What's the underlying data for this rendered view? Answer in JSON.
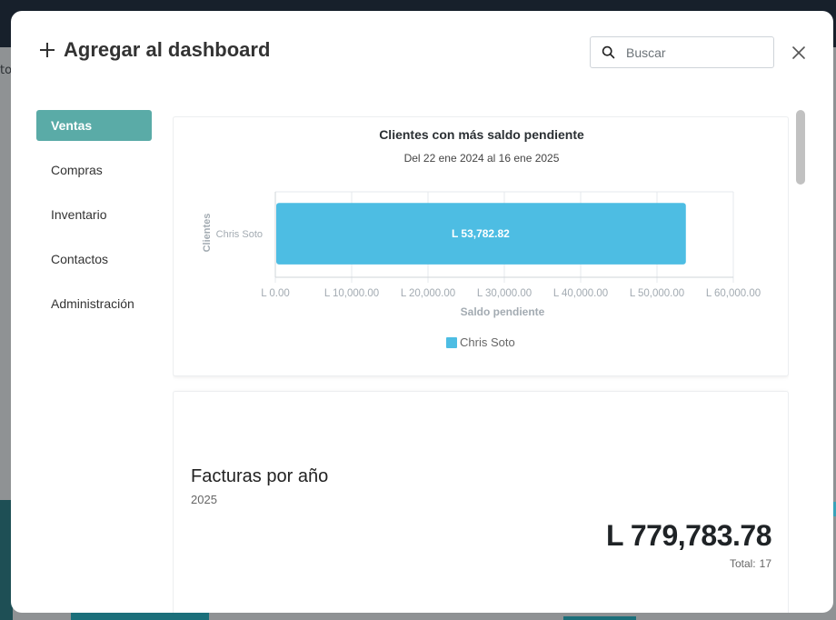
{
  "background": {
    "partial_text": "to"
  },
  "modal": {
    "title": "Agregar al dashboard",
    "search_placeholder": "Buscar"
  },
  "sidebar": {
    "items": [
      {
        "label": "Ventas",
        "active": true
      },
      {
        "label": "Compras",
        "active": false
      },
      {
        "label": "Inventario",
        "active": false
      },
      {
        "label": "Contactos",
        "active": false
      },
      {
        "label": "Administración",
        "active": false
      }
    ]
  },
  "widgets": {
    "clientes": {
      "title": "Clientes con más saldo pendiente",
      "subtitle": "Del 22 ene 2024 al 16 ene 2025"
    },
    "facturas": {
      "title": "Facturas por año",
      "year": "2025",
      "amount": "L 779,783.78",
      "total_label": "Total:",
      "total_value": "17"
    }
  },
  "chart_data": {
    "type": "bar",
    "orientation": "horizontal",
    "categories": [
      "Chris Soto"
    ],
    "series": [
      {
        "name": "Chris Soto",
        "values": [
          53782.82
        ]
      }
    ],
    "data_labels": [
      "L 53,782.82"
    ],
    "xlabel": "Saldo pendiente",
    "ylabel": "Clientes",
    "xlim": [
      0,
      60000
    ],
    "xticks": [
      "L 0.00",
      "L 10,000.00",
      "L 20,000.00",
      "L 30,000.00",
      "L 40,000.00",
      "L 50,000.00",
      "L 60,000.00"
    ],
    "legend": "bottom",
    "color": "#4dbde3",
    "grid": true
  }
}
